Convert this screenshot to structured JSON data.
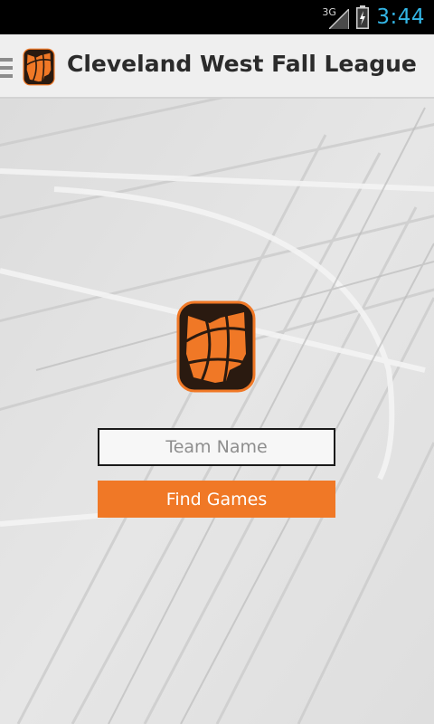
{
  "status_bar": {
    "network_label": "3G",
    "time": "3:44",
    "clock_color": "#33b5e5"
  },
  "action_bar": {
    "title": "Cleveland West Fall League",
    "menu_icon": "drawer-menu-icon",
    "app_icon": "basketball-ohio-logo-icon"
  },
  "form": {
    "team_name_placeholder": "Team Name",
    "team_name_value": "",
    "find_games_label": "Find Games"
  },
  "colors": {
    "accent": "#f07826",
    "logo_dark": "#2a1a10",
    "background": "#e9e9e9"
  }
}
